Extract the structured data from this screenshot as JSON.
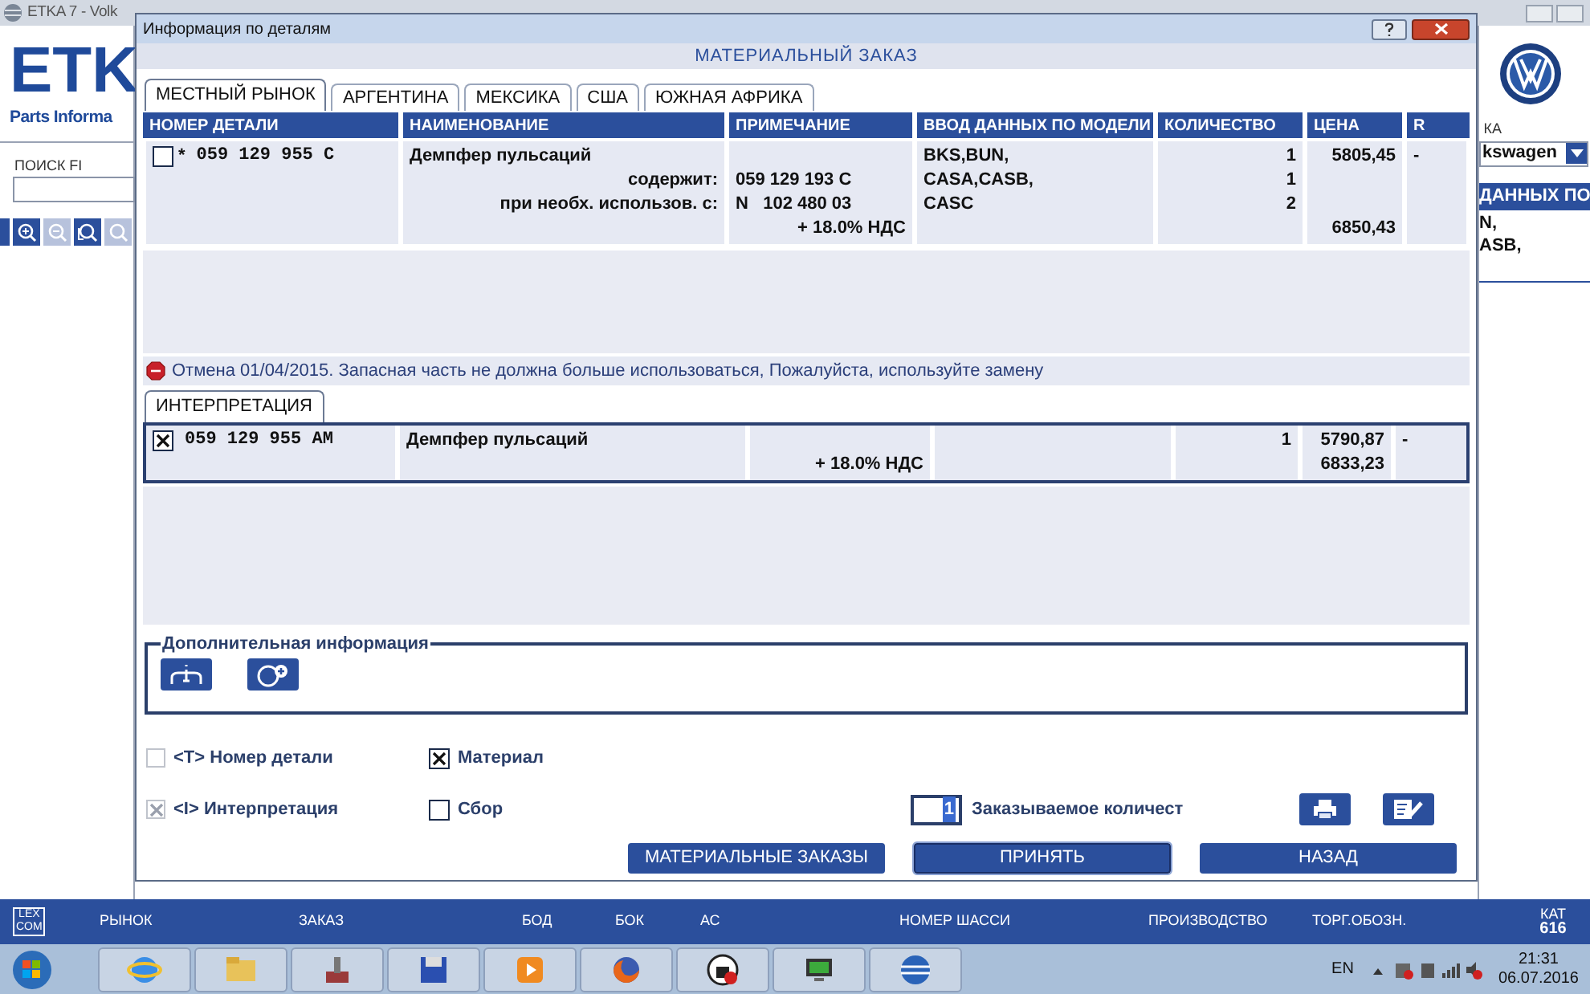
{
  "background_window": {
    "title": "ETKA 7 - Volk",
    "logo": "ETK",
    "logo_subtitle": "Parts Informa",
    "search_label": "ПОИСК FI",
    "zoom_tools": [
      {
        "kind": "zoom-in",
        "disabled": false
      },
      {
        "kind": "zoom-out",
        "disabled": true
      },
      {
        "kind": "zoom-area",
        "disabled": false
      },
      {
        "kind": "zoom-100",
        "disabled": true
      }
    ],
    "right_label": "КА",
    "dropdown_value": "kswagen",
    "right_header": "ДАННЫХ ПО",
    "right_lines": [
      "N,",
      "ASB,"
    ]
  },
  "dialog": {
    "title": "Информация по деталям",
    "heading": "МАТЕРИАЛЬНЫЙ ЗАКАЗ",
    "tabs": [
      {
        "label": "МЕСТНЫЙ РЫНОК",
        "selected": true
      },
      {
        "label": "АРГЕНТИНА",
        "selected": false
      },
      {
        "label": "МЕКСИКА",
        "selected": false
      },
      {
        "label": "США",
        "selected": false
      },
      {
        "label": "ЮЖНАЯ АФРИКА",
        "selected": false
      }
    ],
    "table": {
      "columns": [
        "НОМЕР ДЕТАЛИ",
        "НАИМЕНОВАНИЕ",
        "ПРИМЕЧАНИЕ",
        "ВВОД ДАННЫХ ПО МОДЕЛИ",
        "КОЛИЧЕСТВО",
        "ЦЕНА",
        "R"
      ],
      "rows": [
        {
          "checked": false,
          "selected": false,
          "lines": [
            {
              "kind": "main",
              "mark": "*",
              "part_number": "059 129 955 C",
              "name": "Демпфер пульсаций",
              "model": "BKS,BUN,",
              "quantity": "1",
              "price": "5805,45",
              "r": "-"
            },
            {
              "kind": "detail",
              "name": "содержит:",
              "note": "059 129 193 C",
              "model": "CASA,CASB,",
              "quantity": "1"
            },
            {
              "kind": "detail",
              "name": "при необх. использов. с:",
              "note": "N   102 480 03",
              "model": "CASC",
              "quantity": "2"
            },
            {
              "kind": "tax",
              "note": "+ 18.0% НДС",
              "price": "6850,43"
            }
          ]
        }
      ]
    },
    "notice": "Отмена 01/04/2015. Запасная часть не должна больше использоваться, Пожалуйста, используйте замену",
    "interpretation_tab": {
      "label": "ИНТЕРПРЕТАЦИЯ",
      "selected": true
    },
    "interpretation": {
      "rows": [
        {
          "checked": true,
          "selected": true,
          "lines": [
            {
              "kind": "main",
              "part_number": "059 129 955 AM",
              "name": "Демпфер пульсаций",
              "quantity": "1",
              "price": "5790,87",
              "r": "-"
            },
            {
              "kind": "tax",
              "note": "+ 18.0% НДС",
              "price": "6833,23"
            }
          ]
        }
      ]
    },
    "additional_info": {
      "title": "Дополнительная информация"
    },
    "options": [
      {
        "label": "<T> Номер детали",
        "checked": false,
        "disabled": true
      },
      {
        "label": "Материал",
        "checked": true,
        "disabled": false
      },
      {
        "label": "<I> Интерпретация",
        "checked": true,
        "disabled": true
      },
      {
        "label": "Сбор",
        "checked": false,
        "disabled": false
      }
    ],
    "order_quantity": {
      "value": "1",
      "label": "Заказываемое количест"
    },
    "buttons": [
      {
        "label": "МАТЕРИАЛЬНЫЕ ЗАКАЗЫ",
        "selected": false
      },
      {
        "label": "ПРИНЯТЬ",
        "selected": true
      },
      {
        "label": "НАЗАД",
        "selected": false
      }
    ]
  },
  "status_bar": {
    "logo": [
      "LEX",
      "COM"
    ],
    "items": [
      "РЫНОК",
      "ЗАКАЗ",
      "БОД",
      "БОК",
      "АС",
      "НОМЕР ШАССИ",
      "ПРОИЗВОДСТВО",
      "ТОРГ.ОБОЗН."
    ],
    "catalog_label": "КАТ",
    "catalog_value": "616"
  },
  "taskbar": {
    "language": "EN",
    "time": "21:31",
    "date": "06.07.2016"
  }
}
